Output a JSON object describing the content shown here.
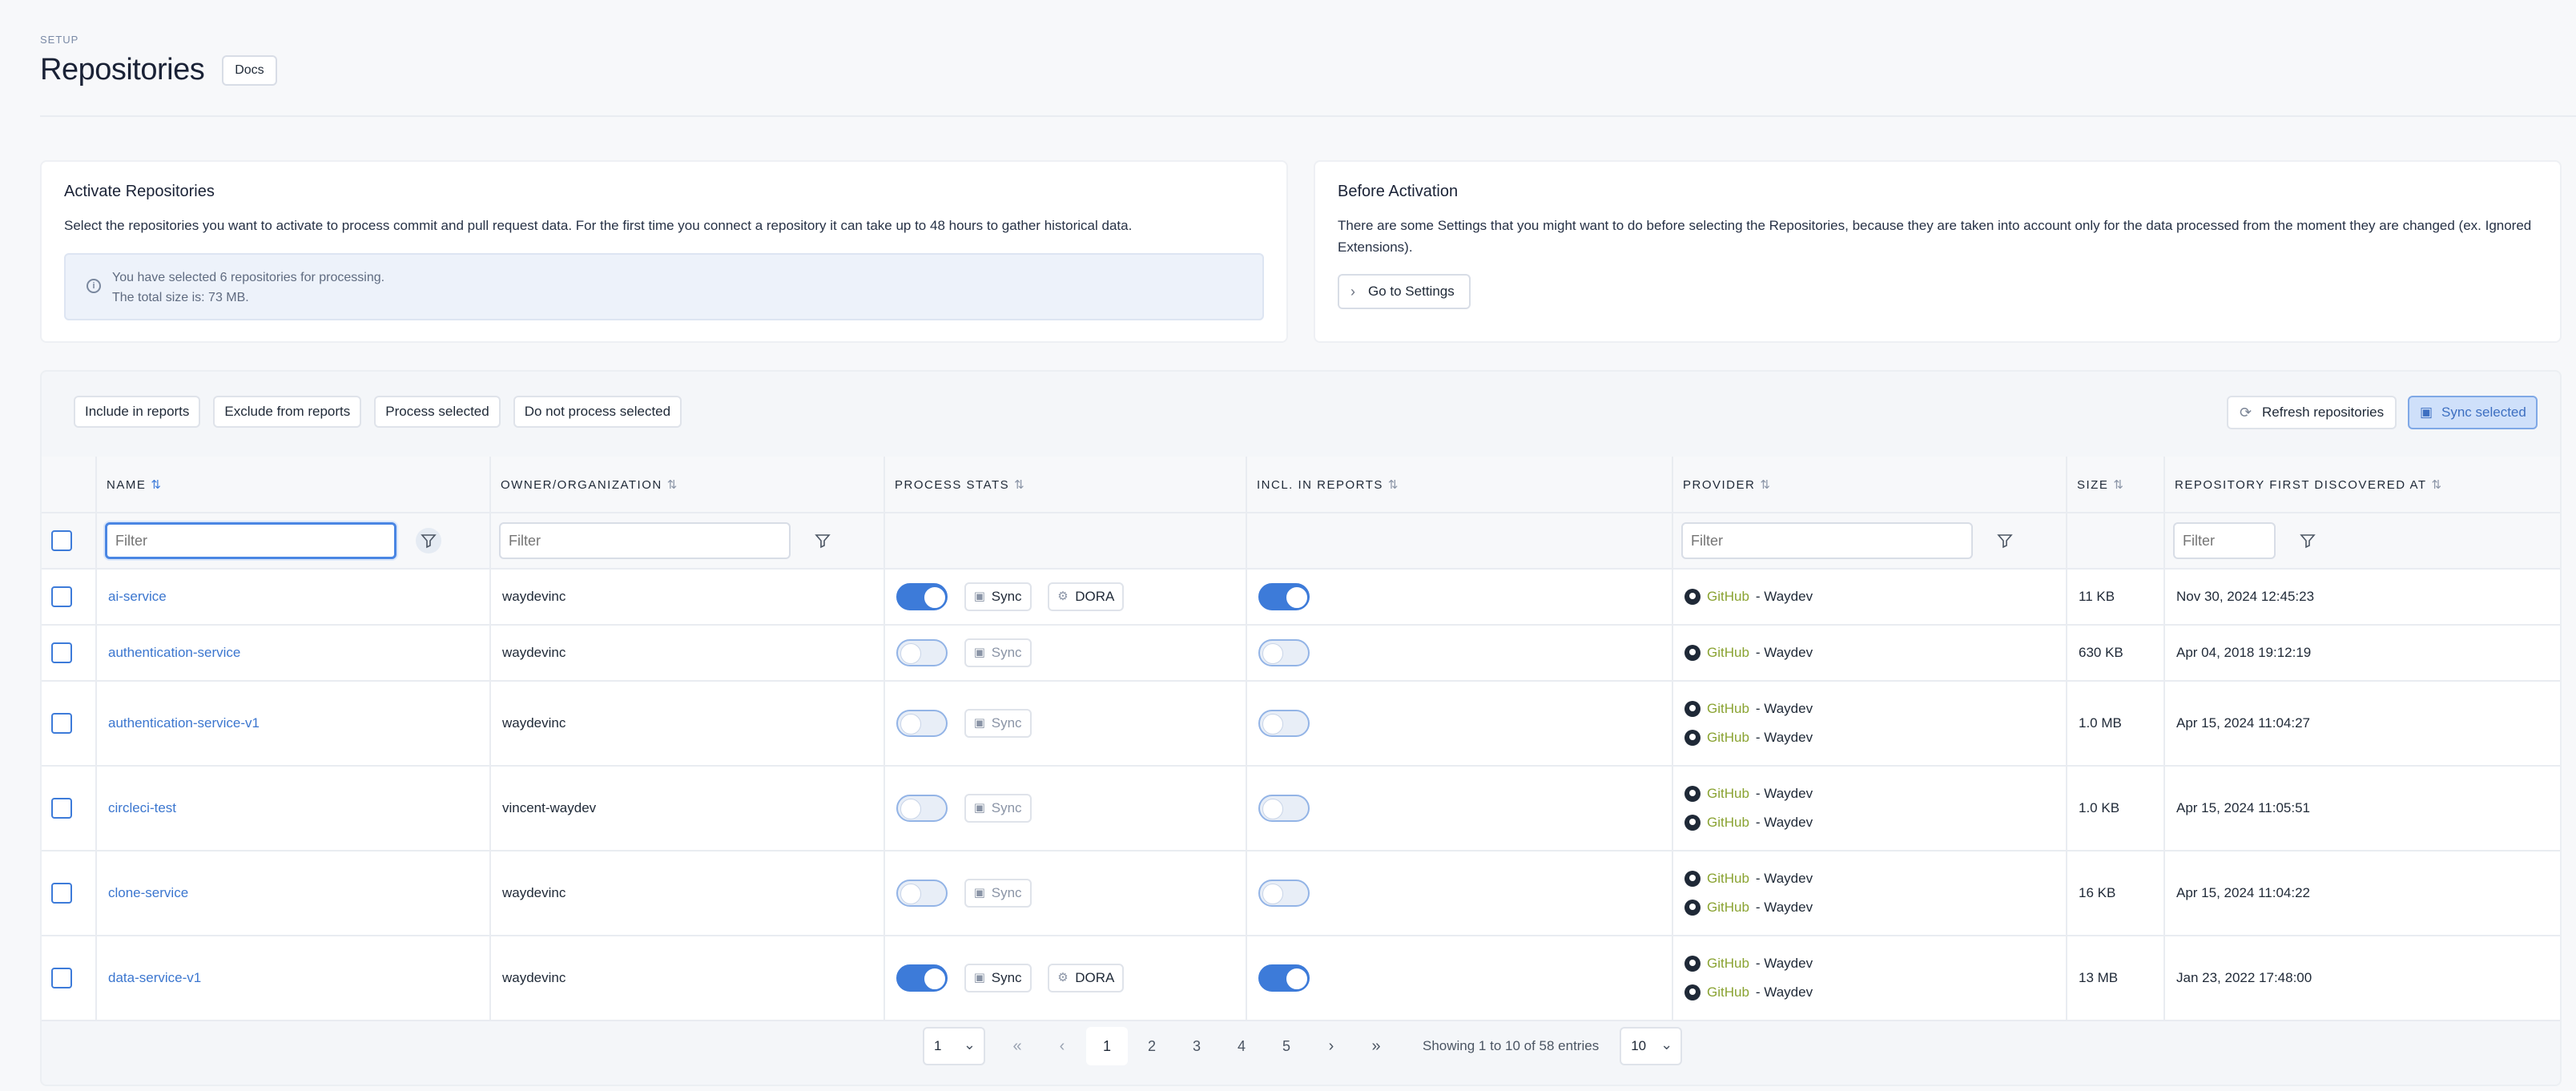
{
  "header": {
    "breadcrumb": "SETUP",
    "title": "Repositories",
    "docs_label": "Docs"
  },
  "activate_card": {
    "title": "Activate Repositories",
    "description": "Select the repositories you want to activate to process commit and pull request data. For the first time you connect a repository it can take up to 48 hours to gather historical data.",
    "info_line1": "You have selected 6 repositories for processing.",
    "info_line2": "The total size is: 73 MB."
  },
  "before_card": {
    "title": "Before Activation",
    "description": "There are some Settings that you might want to do before selecting the Repositories, because they are taken into account only for the data processed from the moment they are changed (ex. Ignored Extensions).",
    "settings_label": "Go to Settings"
  },
  "toolbar": {
    "include": "Include in reports",
    "exclude": "Exclude from reports",
    "process": "Process selected",
    "no_process": "Do not process selected",
    "refresh": "Refresh repositories",
    "sync_selected": "Sync selected"
  },
  "columns": {
    "name": "NAME",
    "owner": "OWNER/ORGANIZATION",
    "process": "PROCESS STATS",
    "incl": "INCL. IN REPORTS",
    "provider": "PROVIDER",
    "size": "SIZE",
    "discovered": "REPOSITORY FIRST DISCOVERED AT"
  },
  "filter_placeholder": "Filter",
  "labels": {
    "sync": "Sync",
    "dora": "DORA",
    "github": "GitHub",
    "sep_org": " - Waydev"
  },
  "rows": [
    {
      "name": "ai-service",
      "owner": "waydevinc",
      "process": true,
      "dora": true,
      "incl": true,
      "providers": 1,
      "size": "11 KB",
      "date": "Nov 30, 2024 12:45:23"
    },
    {
      "name": "authentication-service",
      "owner": "waydevinc",
      "process": false,
      "dora": false,
      "incl": false,
      "providers": 1,
      "size": "630 KB",
      "date": "Apr 04, 2018 19:12:19"
    },
    {
      "name": "authentication-service-v1",
      "owner": "waydevinc",
      "process": false,
      "dora": false,
      "incl": false,
      "providers": 2,
      "size": "1.0 MB",
      "date": "Apr 15, 2024 11:04:27"
    },
    {
      "name": "circleci-test",
      "owner": "vincent-waydev",
      "process": false,
      "dora": false,
      "incl": false,
      "providers": 2,
      "size": "1.0 KB",
      "date": "Apr 15, 2024 11:05:51"
    },
    {
      "name": "clone-service",
      "owner": "waydevinc",
      "process": false,
      "dora": false,
      "incl": false,
      "providers": 2,
      "size": "16 KB",
      "date": "Apr 15, 2024 11:04:22"
    },
    {
      "name": "data-service-v1",
      "owner": "waydevinc",
      "process": true,
      "dora": true,
      "incl": true,
      "providers": 2,
      "size": "13 MB",
      "date": "Jan 23, 2022 17:48:00"
    }
  ],
  "pagination": {
    "page_select": "1",
    "pages": [
      "1",
      "2",
      "3",
      "4",
      "5"
    ],
    "showing": "Showing 1 to 10 of 58 entries",
    "per_page": "10"
  }
}
